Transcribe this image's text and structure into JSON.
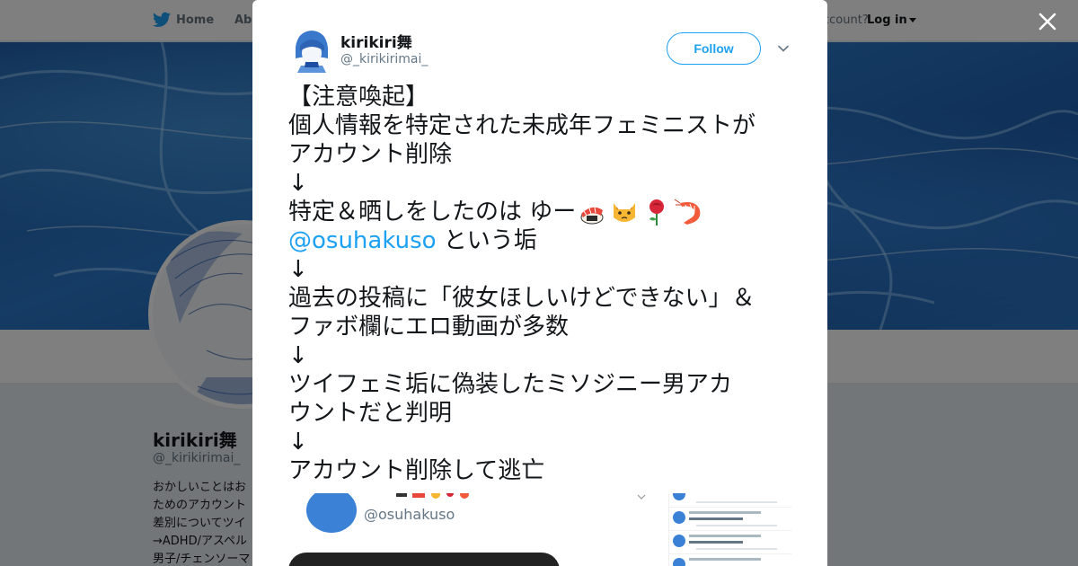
{
  "nav": {
    "home_label": "Home",
    "about_label": "Abo",
    "account_text": "ccount?",
    "login_label": "Log in"
  },
  "profile": {
    "name": "kirikiri舞",
    "handle": "@_kirikirimai_",
    "bio_lines": [
      "おかしいことはお",
      "ためのアカウント",
      "差別についてツイ",
      "→ADHD/アスペル",
      "男子/チェンソーマ"
    ]
  },
  "tweet": {
    "author_name": "kirikiri舞",
    "author_handle": "@_kirikirimai_",
    "follow_label": "Follow",
    "lines": {
      "l1": "【注意喚起】",
      "l2": "個人情報を特定された未成年フェミニストが",
      "l3": "アカウント削除",
      "l4": "↓",
      "l5": "特定＆晒しをしたのは  ゆー",
      "l6_mention": "@osuhakuso",
      "l6_rest": " という垢",
      "l7": "↓",
      "l8": "過去の投稿に「彼女ほしいけどできない」＆",
      "l9": "ファボ欄にエロ動画が多数",
      "l10": "↓",
      "l11": "ツイフェミ垢に偽装したミソジニー男アカ",
      "l12": "ウントだと判明",
      "l13": "↓",
      "l14": "アカウント削除して逃亡"
    },
    "emojis": [
      "sushi-icon",
      "cat-icon",
      "rose-icon",
      "shrimp-icon"
    ],
    "embedded_handle": "@osuhakuso"
  },
  "colors": {
    "accent": "#1da1f2",
    "text": "#14171a",
    "muted": "#657786"
  }
}
